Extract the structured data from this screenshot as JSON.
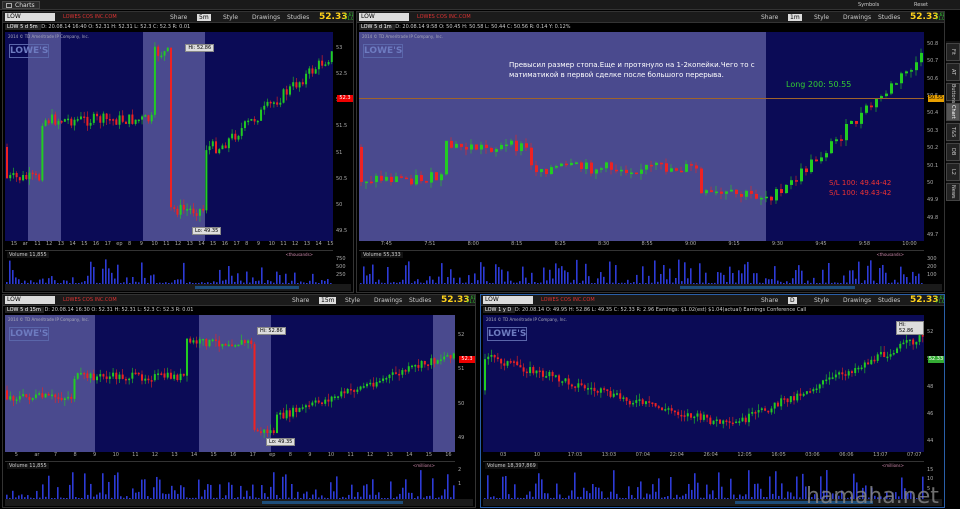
{
  "app": {
    "tab_label": "Charts"
  },
  "top_right": {
    "symbols": "Symbols",
    "reset": "Reset"
  },
  "side_tabs": [
    "Fit",
    "AT",
    "Buttons",
    "Chart",
    "T&S",
    "DB",
    "L2",
    "News"
  ],
  "colors": {
    "up": "#22cc22",
    "down": "#ee2222",
    "bg": "#0b0b56",
    "price": "#ffd21a"
  },
  "panels": [
    {
      "symbol": "LOW",
      "company": "LOWES COS INC.COM",
      "interval": "5m",
      "share": "Share",
      "style": "Style",
      "drawings": "Drawings",
      "studies": "Studies",
      "price": "52.33",
      "chg1": "+.61",
      "chg2": "+1.01%",
      "info": [
        "LOW 5 d 5m",
        "D: 20.08.14 16:40",
        "O: 52.31",
        "H: 52.31",
        "L: 52.3",
        "C: 52.3",
        "R: 0.01"
      ],
      "copyright": "2014 © TD Ameritrade IP Company, Inc.",
      "logo": "LOWE'S",
      "yticks": [
        "53",
        "52.5",
        "52",
        "51.5",
        "51",
        "50.5",
        "50",
        "49.5"
      ],
      "xticks": [
        "15",
        "ar",
        "11",
        "12",
        "13",
        "14",
        "15",
        "16",
        "17",
        "ep",
        "8",
        "9",
        "10",
        "11",
        "12",
        "13",
        "14",
        "15",
        "16",
        "17",
        "8",
        "9",
        "10",
        "11",
        "12",
        "13",
        "14",
        "15"
      ],
      "hi": "Hi: 52.86",
      "lo": "Lo: 49.35",
      "lastprice": "52.3",
      "voltext": "11,855",
      "vol_label": "Volume",
      "vol_unit": "thousands",
      "vol_ticks": [
        "750",
        "500",
        "250"
      ]
    },
    {
      "symbol": "LOW",
      "company": "LOWES COS INC.COM",
      "interval": "1m",
      "share": "Share",
      "style": "Style",
      "drawings": "Drawings",
      "studies": "Studies",
      "price": "52.33",
      "chg1": "+.61",
      "chg2": "+1.01%",
      "info": [
        "LOW 5 d 1m",
        "D: 20.08.14 9:58",
        "O: 50.45",
        "H: 50.58",
        "L: 50.44",
        "C: 50.56",
        "R: 0.14",
        "Y: 0.12%"
      ],
      "copyright": "2014 © TD Ameritrade IP Company, Inc.",
      "logo": "LOWE'S",
      "note": "Превысил размер стопа.Еще и протянуло на 1-2копейки.Чего то с матиматикой в первой сделке после большого перерыва.",
      "long_label": "Long 200: 50.55",
      "sl1": "S/L 100: 49.44-42",
      "sl2": "S/L 100: 49.43-42",
      "yticks": [
        "50.8",
        "50.7",
        "50.6",
        "50.5",
        "50.4",
        "50.3",
        "50.2",
        "50.1",
        "50",
        "49.9",
        "49.8",
        "49.7"
      ],
      "xticks": [
        "7:45",
        "7:51",
        "8:00",
        "8:15",
        "8:25",
        "8:30",
        "8:55",
        "9:00",
        "9:15",
        "9:30",
        "9:45",
        "9:58",
        "10:00"
      ],
      "lastprice": "50.55",
      "voltext": "55,333",
      "vol_label": "Volume",
      "vol_unit": "thousands",
      "vol_ticks": [
        "300",
        "200",
        "100"
      ]
    },
    {
      "symbol": "LOW",
      "company": "LOWES COS INC.COM",
      "interval": "15m",
      "share": "Share",
      "style": "Style",
      "drawings": "Drawings",
      "studies": "Studies",
      "price": "52.33",
      "chg1": "+.61",
      "chg2": "+1.01%",
      "info": [
        "LOW 5 d 15m",
        "D: 20.08.14 16:30",
        "O: 52.31",
        "H: 52.31",
        "L: 52.3",
        "C: 52.3",
        "R: 0.01"
      ],
      "copyright": "2014 © TD Ameritrade IP Company, Inc.",
      "logo": "LOWE'S",
      "yticks": [
        "52",
        "51",
        "50",
        "49"
      ],
      "xticks": [
        "5",
        "ar",
        "7",
        "8",
        "9",
        "10",
        "11",
        "12",
        "13",
        "14",
        "15",
        "16",
        "17",
        "ep",
        "8",
        "9",
        "10",
        "11",
        "12",
        "13",
        "14",
        "15",
        "16"
      ],
      "hi": "Hi: 52.86",
      "lo": "Lo: 49.35",
      "lastprice": "52.3",
      "voltext": "11,855",
      "vol_label": "Volume",
      "vol_unit": "millions",
      "vol_ticks": [
        "2",
        "1"
      ]
    },
    {
      "symbol": "LOW",
      "company": "LOWES COS INC.COM",
      "interval": "D",
      "share": "Share",
      "style": "Style",
      "drawings": "Drawings",
      "studies": "Studies",
      "price": "52.33",
      "chg1": "+.61",
      "chg2": "+1.01%",
      "info": [
        "LOW 1 y D",
        "D: 20.08.14",
        "O: 49.95",
        "H: 52.86",
        "L: 49.35",
        "C: 52.33",
        "R: 2.96",
        "Earnings: $1.02(est) $1.04(actual)",
        "Earnings Conference Call"
      ],
      "copyright": "2014 © TD Ameritrade IP Company, Inc.",
      "logo": "LOWE'S",
      "yticks": [
        "52",
        "50",
        "48",
        "46",
        "44"
      ],
      "xticks": [
        "03",
        "10",
        "17:03",
        "13:03",
        "07:04",
        "22:04",
        "26:04",
        "12:05",
        "16:05",
        "03:06",
        "06:06",
        "13:07",
        "07:07"
      ],
      "hi": "Hi: 52.86",
      "lastprice": "52.33",
      "voltext": "18,397,869",
      "vol_label": "Volume",
      "vol_unit": "millions",
      "vol_ticks": [
        "15",
        "10",
        "5"
      ]
    }
  ],
  "watermark": "hamaha.net"
}
